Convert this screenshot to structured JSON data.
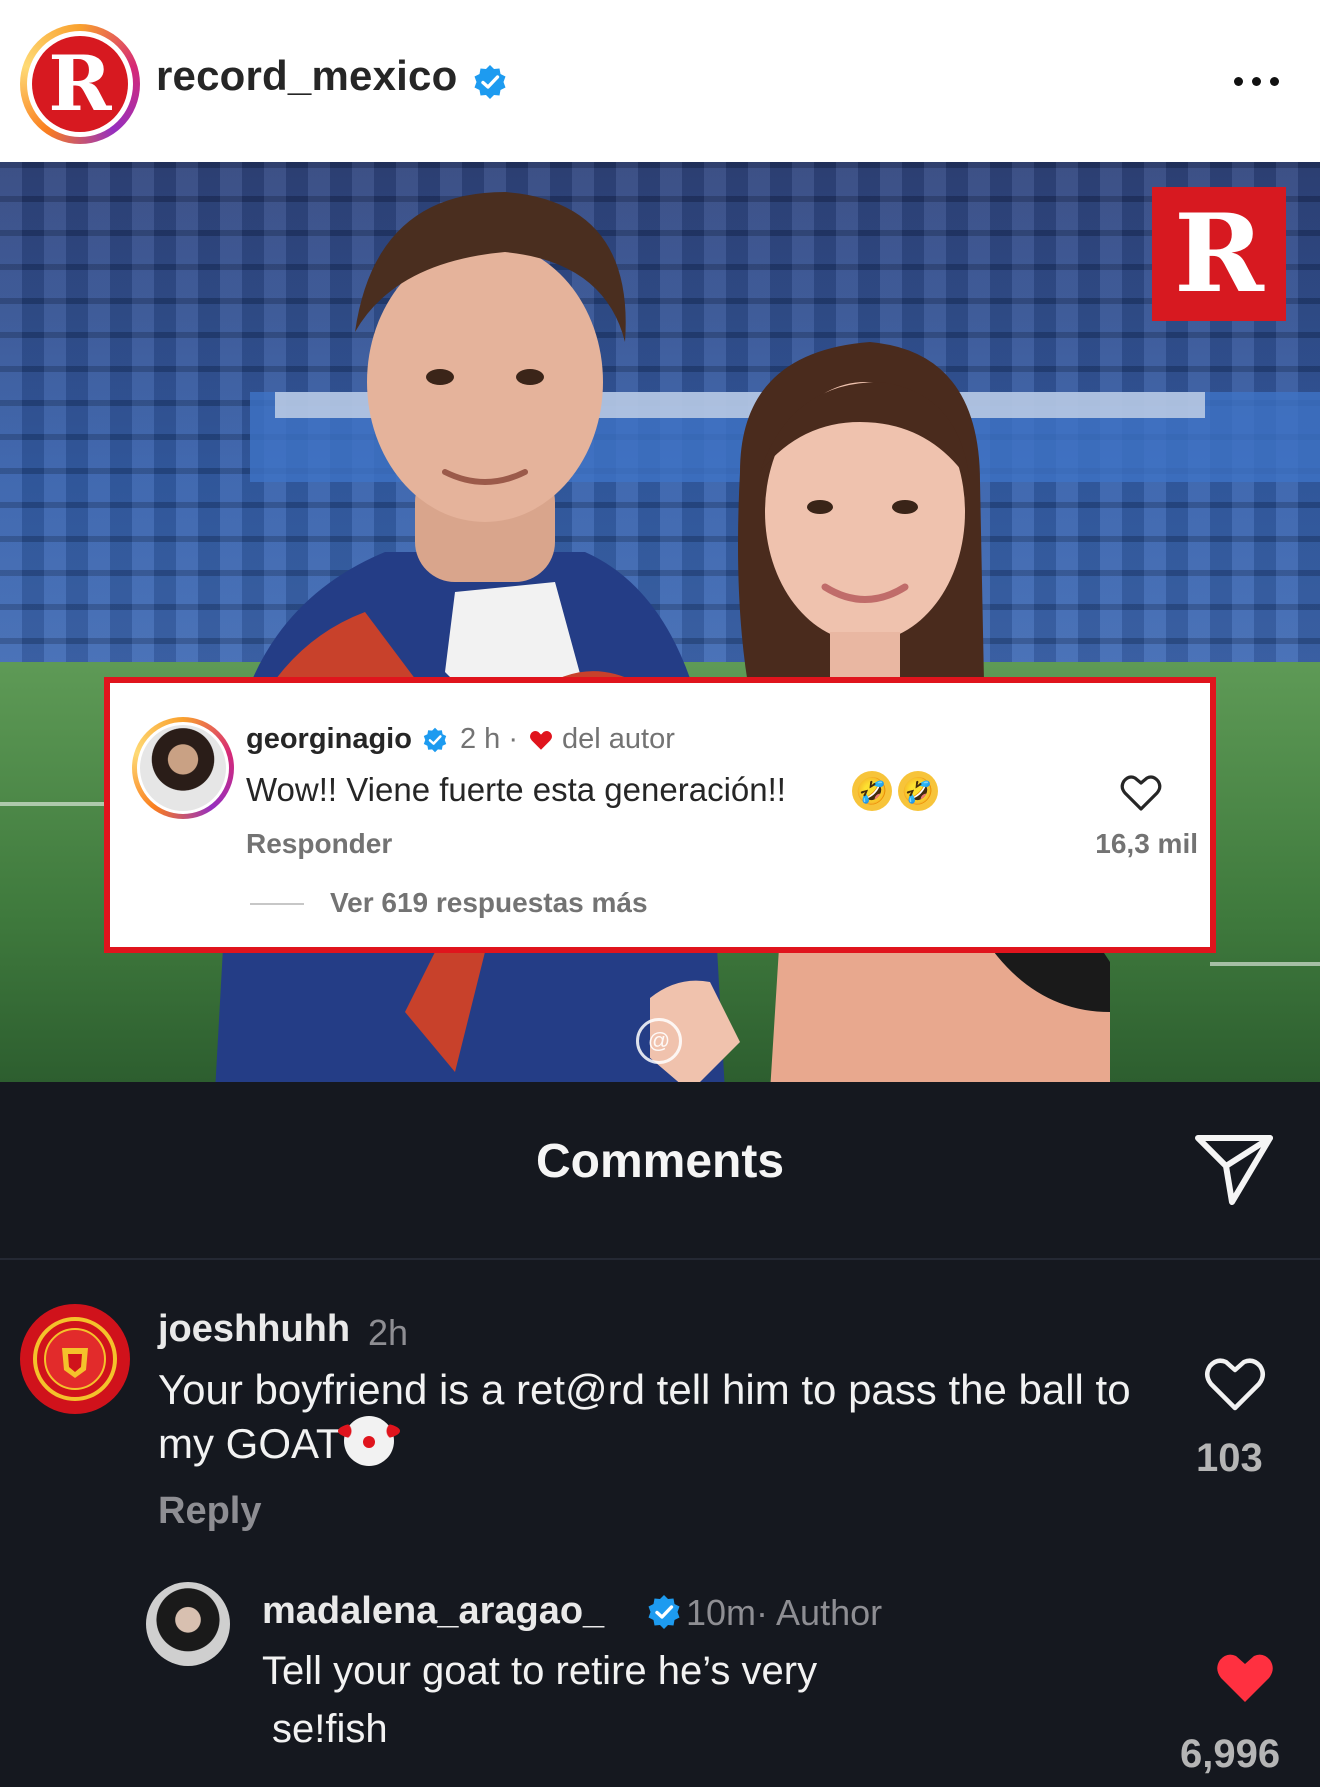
{
  "header": {
    "logo_letter": "R",
    "username": "record_mexico",
    "verified_icon": "verified-badge-icon",
    "more_icon": "more-options-icon"
  },
  "photo": {
    "watermark_letter": "R",
    "threads_icon": "threads-badge-icon"
  },
  "highlight_comment": {
    "username": "georginagio",
    "time": "2 h ·",
    "author_label": "del autor",
    "text": "Wow!! Viene fuerte esta generación!!",
    "emojis": [
      "🤣",
      "🤣"
    ],
    "reply_label": "Responder",
    "like_count": "16,3 mil",
    "view_replies": "Ver 619 respuestas más",
    "border_color": "#e0141d"
  },
  "comments_sheet": {
    "title": "Comments",
    "send_icon": "send-icon",
    "comments": [
      {
        "username": "joeshhuhh",
        "time": "2h",
        "text": "Your boyfriend is a ret@rd tell him to pass the ball to my GOAT",
        "emoji": "🤡",
        "reply_label": "Reply",
        "like_count": "103",
        "liked": false
      },
      {
        "username": "madalena_aragao_",
        "time": "10m· Author",
        "text_line1": "Tell your goat to retire he’s very",
        "text_line2": "se!fish",
        "like_count": "6,996",
        "liked": true,
        "like_color": "#ff3040"
      }
    ]
  }
}
